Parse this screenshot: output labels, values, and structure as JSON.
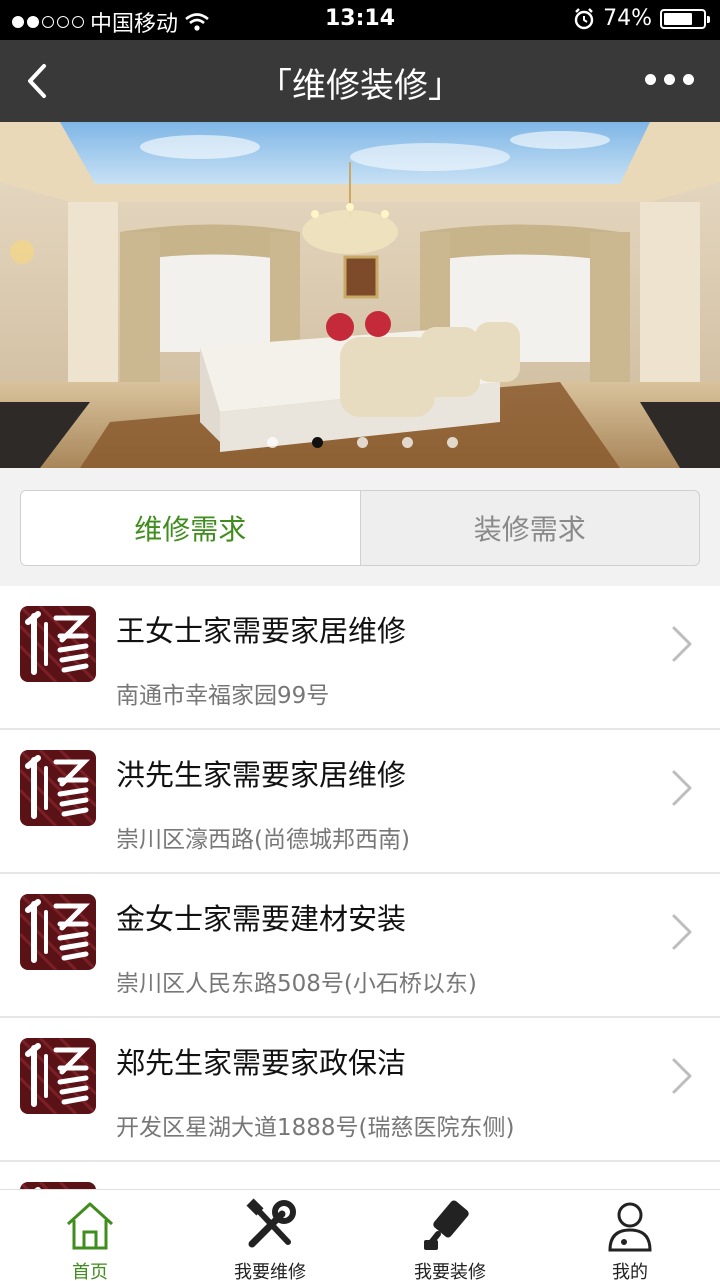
{
  "status_bar": {
    "carrier": "中国移动",
    "time": "13:14",
    "battery": "74%",
    "battery_level": 0.74
  },
  "nav": {
    "title": "「维修装修」",
    "back_icon": "chevron-left-icon",
    "more_icon": "more-dots-icon"
  },
  "banner": {
    "dot_count": 5,
    "active_index": 1
  },
  "tabs": [
    {
      "label": "维修需求",
      "active": true
    },
    {
      "label": "装修需求",
      "active": false
    }
  ],
  "list": [
    {
      "title": "王女士家需要家居维修",
      "address": "南通市幸福家园99号"
    },
    {
      "title": "洪先生家需要家居维修",
      "address": "崇川区濠西路(尚德城邦西南)"
    },
    {
      "title": "金女士家需要建材安装",
      "address": "崇川区人民东路508号(小石桥以东)"
    },
    {
      "title": "郑先生家需要家政保洁",
      "address": "开发区星湖大道1888号(瑞慈医院东侧)"
    }
  ],
  "tabbar": [
    {
      "label": "首页",
      "icon": "home-icon",
      "active": true
    },
    {
      "label": "我要维修",
      "icon": "tools-icon",
      "active": false
    },
    {
      "label": "我要装修",
      "icon": "paint-roller-icon",
      "active": false
    },
    {
      "label": "我的",
      "icon": "user-icon",
      "active": false
    }
  ],
  "colors": {
    "accent": "#3f8d1c",
    "nav_bg": "#393939",
    "thumb_bg": "#5a1216"
  }
}
